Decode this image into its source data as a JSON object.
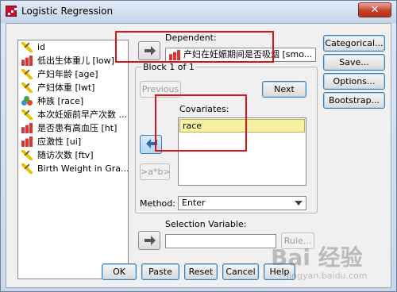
{
  "window": {
    "title": "Logistic Regression",
    "close_glyph": "✕"
  },
  "variables": [
    {
      "icon": "ruler-icon",
      "label": "id"
    },
    {
      "icon": "bars-icon",
      "label": "低出生体重儿 [low]"
    },
    {
      "icon": "ruler-icon",
      "label": "产妇年龄 [age]"
    },
    {
      "icon": "ruler-icon",
      "label": "产妇体重 [lwt]"
    },
    {
      "icon": "balls-icon",
      "label": "种族 [race]"
    },
    {
      "icon": "ruler-icon",
      "label": "本次妊娠前早产次数 ..."
    },
    {
      "icon": "bars-icon",
      "label": "是否患有高血压 [ht]"
    },
    {
      "icon": "bars-icon",
      "label": "应激性 [ui]"
    },
    {
      "icon": "ruler-icon",
      "label": "随访次数 [ftv]"
    },
    {
      "icon": "ruler-icon",
      "label": "Birth Weight in Gra..."
    }
  ],
  "dependent": {
    "label": "Dependent:",
    "value": "产妇在妊娠期间是否吸烟 [smo..."
  },
  "block": {
    "title": "Block 1 of 1",
    "previous": "Previous",
    "next": "Next"
  },
  "covariates": {
    "label": "Covariates:",
    "items": [
      "race"
    ]
  },
  "interaction_button": ">a*b>",
  "method": {
    "label": "Method:",
    "value": "Enter"
  },
  "selection": {
    "label": "Selection Variable:",
    "value": "",
    "rule_button": "Rule..."
  },
  "side_buttons": [
    "Categorical...",
    "Save...",
    "Options...",
    "Bootstrap..."
  ],
  "bottom_buttons": [
    "OK",
    "Paste",
    "Reset",
    "Cancel",
    "Help"
  ],
  "watermark": {
    "brand": "Bai 经验",
    "url": "jingyan.baidu.com"
  }
}
